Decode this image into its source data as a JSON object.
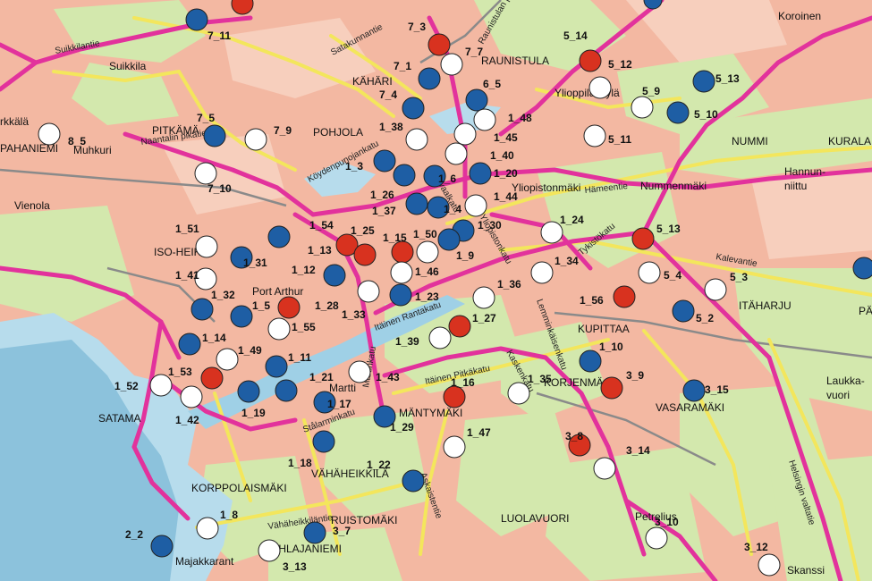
{
  "colors": {
    "urban": "#f3a994",
    "urban_light": "#f7c9b6",
    "green": "#d4e8b0",
    "green_dark": "#b9d98c",
    "water": "#b9dceb",
    "water_dark": "#7fb9d6",
    "road_major": "#e5379f",
    "road_minor": "#f4e85a",
    "road_grey": "#8b8b8b",
    "red_station": "#d9321f",
    "blue_station": "#1f5fa6",
    "white_station": "#ffffff"
  },
  "districts": [
    {
      "id": "koroinen",
      "text": "Koroinen"
    },
    {
      "id": "raunistula",
      "text": "RAUNISTULA"
    },
    {
      "id": "kahari",
      "text": "KÄHÄRI"
    },
    {
      "id": "suikkila",
      "text": "Suikkila"
    },
    {
      "id": "pitkamaki",
      "text": "PITKÄMÄ"
    },
    {
      "id": "pohjola",
      "text": "POHJOLA"
    },
    {
      "id": "ylioppilaskyla",
      "text": "Ylioppilaskylä"
    },
    {
      "id": "nummi",
      "text": "NUMMI"
    },
    {
      "id": "kurala",
      "text": "KURALA"
    },
    {
      "id": "hannunniittu1",
      "text": "Hannun-"
    },
    {
      "id": "hannunniittu2",
      "text": "niittu"
    },
    {
      "id": "nummenmaki",
      "text": "Nummenmäki"
    },
    {
      "id": "yliopistonmaki",
      "text": "Yliopistonmäki"
    },
    {
      "id": "muhkuri",
      "text": "Muhkuri"
    },
    {
      "id": "vienola",
      "text": "Vienola"
    },
    {
      "id": "pahaniemi",
      "text": "PAHANIEMI"
    },
    {
      "id": "rkkala",
      "text": "rkkälä"
    },
    {
      "id": "isoheikkila",
      "text": "ISO-HEIKI"
    },
    {
      "id": "portarthur",
      "text": "Port Arthur"
    },
    {
      "id": "itaharju",
      "text": "ITÄHARJU"
    },
    {
      "id": "kupittaa",
      "text": "KUPITTAA"
    },
    {
      "id": "korjenmaki",
      "text": "KORJENMÄ"
    },
    {
      "id": "vasaramaki",
      "text": "VASARAMÄKI"
    },
    {
      "id": "laukkavuori1",
      "text": "Laukka-"
    },
    {
      "id": "laukkavuori2",
      "text": "vuori"
    },
    {
      "id": "satama",
      "text": "SATAMA"
    },
    {
      "id": "martti",
      "text": "Martti"
    },
    {
      "id": "mantymaki",
      "text": "MÄNTYMÄKI"
    },
    {
      "id": "vahaheikkila",
      "text": "VÄHÄHEIKKILÄ"
    },
    {
      "id": "korppolaismaki",
      "text": "KORPPOLAISMÄKI"
    },
    {
      "id": "luolavuori",
      "text": "LUOLAVUORI"
    },
    {
      "id": "petrelius",
      "text": "Petrelius"
    },
    {
      "id": "ruistomaki",
      "text": "RUISTOMÄKI"
    },
    {
      "id": "ihlajaniemi",
      "text": "IHLAJANIEMI"
    },
    {
      "id": "majakkaranta",
      "text": "Majakkarant"
    },
    {
      "id": "skanssi",
      "text": "Skanssi"
    },
    {
      "id": "pa",
      "text": "PÄ"
    }
  ],
  "road_labels": [
    {
      "id": "suikkilantie",
      "text": "Suikkilantie"
    },
    {
      "id": "satakunnantie",
      "text": "Satakunnantie"
    },
    {
      "id": "raunistulan",
      "text": "Raunistulan puisto"
    },
    {
      "id": "naantalin",
      "text": "Naantalin pikatie"
    },
    {
      "id": "koydenpunoja",
      "text": "Köydenpunojankatu"
    },
    {
      "id": "hameentie",
      "text": "Hämeentie"
    },
    {
      "id": "kalevantie",
      "text": "Kalevantie"
    },
    {
      "id": "itainen_rantakatu",
      "text": "Itäinen Rantakatu"
    },
    {
      "id": "itainen_pitkakatu",
      "text": "Itäinen Pitkäkatu"
    },
    {
      "id": "lemminkaisenkatu",
      "text": "Lemminkäisenkatu"
    },
    {
      "id": "stalarminkatu",
      "text": "Stålarminkatu"
    },
    {
      "id": "vahaheikkilantie",
      "text": "Vähäheikkiläntie"
    },
    {
      "id": "helsingin_valtatie",
      "text": "Helsingin valtatie"
    },
    {
      "id": "tykistokatu",
      "text": "Tykistökatu"
    },
    {
      "id": "kaskenkatu",
      "text": "Kaskenkatu"
    },
    {
      "id": "vaalkatu",
      "text": "vaalkatu"
    },
    {
      "id": "yliopistonkatu",
      "text": "Yliopistonkatu"
    },
    {
      "id": "askaistentie",
      "text": "Askaistentie"
    },
    {
      "id": "martinkatu",
      "text": "Martinkatu"
    }
  ],
  "stations": [
    {
      "label": "7_11",
      "color": "blue"
    },
    {
      "label": "7_3",
      "color": "red"
    },
    {
      "label": "7_7",
      "color": "white"
    },
    {
      "label": "7_1",
      "color": "blue"
    },
    {
      "label": "6_5",
      "color": "blue"
    },
    {
      "label": "7_4",
      "color": "blue"
    },
    {
      "label": "7_5",
      "color": "blue"
    },
    {
      "label": "7_9",
      "color": "white"
    },
    {
      "label": "8_5",
      "color": "white"
    },
    {
      "label": "7_10",
      "color": "white"
    },
    {
      "label": "1_38",
      "color": "white"
    },
    {
      "label": "1_3",
      "color": "blue"
    },
    {
      "label": "1_48",
      "color": "white"
    },
    {
      "label": "1_45",
      "color": "white"
    },
    {
      "label": "1_40",
      "color": "white"
    },
    {
      "label": "1_20",
      "color": "blue"
    },
    {
      "label": "1_6",
      "color": "blue"
    },
    {
      "label": "1_26",
      "color": "blue"
    },
    {
      "label": "1_44",
      "color": "white"
    },
    {
      "label": "1_37",
      "color": "blue"
    },
    {
      "label": "1_4",
      "color": "blue"
    },
    {
      "label": "1_30",
      "color": "blue"
    },
    {
      "label": "1_50",
      "color": "blue"
    },
    {
      "label": "1_54",
      "color": "blue"
    },
    {
      "label": "1_25",
      "color": "red"
    },
    {
      "label": "1_15",
      "color": "red"
    },
    {
      "label": "1_13",
      "color": "red"
    },
    {
      "label": "1_9",
      "color": "white"
    },
    {
      "label": "1_51",
      "color": "white"
    },
    {
      "label": "1_31",
      "color": "blue"
    },
    {
      "label": "1_12",
      "color": "blue"
    },
    {
      "label": "1_46",
      "color": "white"
    },
    {
      "label": "1_41",
      "color": "white"
    },
    {
      "label": "1_23",
      "color": "blue"
    },
    {
      "label": "1_32",
      "color": "blue"
    },
    {
      "label": "1_28",
      "color": "red"
    },
    {
      "label": "1_33",
      "color": "white"
    },
    {
      "label": "1_5",
      "color": "blue"
    },
    {
      "label": "1_55",
      "color": "white"
    },
    {
      "label": "1_14",
      "color": "blue"
    },
    {
      "label": "1_49",
      "color": "white"
    },
    {
      "label": "1_11",
      "color": "blue"
    },
    {
      "label": "1_53",
      "color": "red"
    },
    {
      "label": "1_52",
      "color": "white"
    },
    {
      "label": "1_21",
      "color": "blue"
    },
    {
      "label": "1_43",
      "color": "white"
    },
    {
      "label": "1_19",
      "color": "blue"
    },
    {
      "label": "1_17",
      "color": "blue"
    },
    {
      "label": "1_42",
      "color": "white"
    },
    {
      "label": "1_18",
      "color": "blue"
    },
    {
      "label": "1_29",
      "color": "blue"
    },
    {
      "label": "1_22",
      "color": "blue"
    },
    {
      "label": "1_8",
      "color": "white"
    },
    {
      "label": "2_2",
      "color": "blue"
    },
    {
      "label": "3_7",
      "color": "blue"
    },
    {
      "label": "3_13",
      "color": "white"
    },
    {
      "label": "1_39",
      "color": "white"
    },
    {
      "label": "1_27",
      "color": "red"
    },
    {
      "label": "1_36",
      "color": "white"
    },
    {
      "label": "1_16",
      "color": "red"
    },
    {
      "label": "1_47",
      "color": "white"
    },
    {
      "label": "1_35",
      "color": "white"
    },
    {
      "label": "1_34",
      "color": "white"
    },
    {
      "label": "1_24",
      "color": "white"
    },
    {
      "label": "1_56",
      "color": "red"
    },
    {
      "label": "1_10",
      "color": "blue"
    },
    {
      "label": "3_9",
      "color": "red"
    },
    {
      "label": "3_8",
      "color": "red"
    },
    {
      "label": "3_14",
      "color": "white"
    },
    {
      "label": "3_10",
      "color": "white"
    },
    {
      "label": "3_12",
      "color": "white"
    },
    {
      "label": "3_15",
      "color": "blue"
    },
    {
      "label": "5_13",
      "color": "red"
    },
    {
      "label": "5_4",
      "color": "white"
    },
    {
      "label": "5_3",
      "color": "white"
    },
    {
      "label": "5_2",
      "color": "blue"
    },
    {
      "label": "5_14",
      "color": "red"
    },
    {
      "label": "5_12",
      "color": "white"
    },
    {
      "label": "5_9",
      "color": "white"
    },
    {
      "label": "5_10",
      "color": "blue"
    },
    {
      "label": "5_11",
      "color": "white"
    },
    {
      "label": "5_13",
      "color": "blue"
    }
  ]
}
